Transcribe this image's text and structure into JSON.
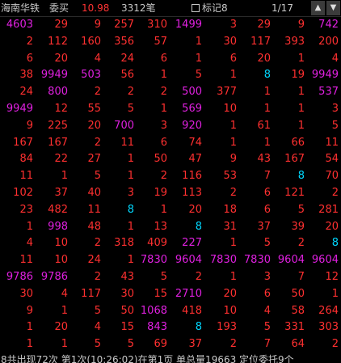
{
  "header": {
    "stock_name": "海南华铁",
    "order_type": "委买",
    "price": "10.98",
    "order_count": "3312笔",
    "mark_label": "标记8",
    "page": "1/17",
    "nav_up_icon": "triangle-up-icon",
    "nav_down_icon": "triangle-down-icon"
  },
  "colors": {
    "red": "#ff3030",
    "magenta": "#e020e0",
    "cyan": "#00d8ff",
    "background": "#000000"
  },
  "rows": [
    [
      [
        "4603",
        "m"
      ],
      [
        "29",
        "r"
      ],
      [
        "9",
        "r"
      ],
      [
        "257",
        "r"
      ],
      [
        "310",
        "r"
      ],
      [
        "1499",
        "m"
      ],
      [
        "3",
        "r"
      ],
      [
        "29",
        "r"
      ],
      [
        "9",
        "r"
      ],
      [
        "742",
        "m"
      ]
    ],
    [
      [
        "2",
        "r"
      ],
      [
        "112",
        "r"
      ],
      [
        "160",
        "r"
      ],
      [
        "356",
        "r"
      ],
      [
        "57",
        "r"
      ],
      [
        "1",
        "r"
      ],
      [
        "30",
        "r"
      ],
      [
        "117",
        "r"
      ],
      [
        "393",
        "r"
      ],
      [
        "200",
        "r"
      ]
    ],
    [
      [
        "6",
        "r"
      ],
      [
        "20",
        "r"
      ],
      [
        "4",
        "r"
      ],
      [
        "24",
        "r"
      ],
      [
        "6",
        "r"
      ],
      [
        "1",
        "r"
      ],
      [
        "6",
        "r"
      ],
      [
        "20",
        "r"
      ],
      [
        "1",
        "r"
      ],
      [
        "4",
        "r"
      ]
    ],
    [
      [
        "38",
        "r"
      ],
      [
        "9949",
        "m"
      ],
      [
        "503",
        "m"
      ],
      [
        "56",
        "r"
      ],
      [
        "1",
        "r"
      ],
      [
        "5",
        "r"
      ],
      [
        "1",
        "r"
      ],
      [
        "8",
        "c"
      ],
      [
        "19",
        "r"
      ],
      [
        "9949",
        "m"
      ]
    ],
    [
      [
        "24",
        "r"
      ],
      [
        "800",
        "m"
      ],
      [
        "2",
        "r"
      ],
      [
        "2",
        "r"
      ],
      [
        "2",
        "r"
      ],
      [
        "500",
        "m"
      ],
      [
        "377",
        "r"
      ],
      [
        "1",
        "r"
      ],
      [
        "1",
        "r"
      ],
      [
        "537",
        "m"
      ]
    ],
    [
      [
        "9949",
        "m"
      ],
      [
        "12",
        "r"
      ],
      [
        "55",
        "r"
      ],
      [
        "5",
        "r"
      ],
      [
        "1",
        "r"
      ],
      [
        "569",
        "m"
      ],
      [
        "10",
        "r"
      ],
      [
        "1",
        "r"
      ],
      [
        "1",
        "r"
      ],
      [
        "3",
        "r"
      ]
    ],
    [
      [
        "9",
        "r"
      ],
      [
        "225",
        "r"
      ],
      [
        "20",
        "r"
      ],
      [
        "700",
        "m"
      ],
      [
        "3",
        "r"
      ],
      [
        "920",
        "m"
      ],
      [
        "1",
        "r"
      ],
      [
        "61",
        "r"
      ],
      [
        "1",
        "r"
      ],
      [
        "5",
        "r"
      ]
    ],
    [
      [
        "167",
        "r"
      ],
      [
        "167",
        "r"
      ],
      [
        "2",
        "r"
      ],
      [
        "11",
        "r"
      ],
      [
        "6",
        "r"
      ],
      [
        "74",
        "r"
      ],
      [
        "1",
        "r"
      ],
      [
        "1",
        "r"
      ],
      [
        "66",
        "r"
      ],
      [
        "11",
        "r"
      ]
    ],
    [
      [
        "84",
        "r"
      ],
      [
        "22",
        "r"
      ],
      [
        "27",
        "r"
      ],
      [
        "1",
        "r"
      ],
      [
        "50",
        "r"
      ],
      [
        "47",
        "r"
      ],
      [
        "9",
        "r"
      ],
      [
        "43",
        "r"
      ],
      [
        "167",
        "r"
      ],
      [
        "54",
        "r"
      ]
    ],
    [
      [
        "11",
        "r"
      ],
      [
        "1",
        "r"
      ],
      [
        "5",
        "r"
      ],
      [
        "1",
        "r"
      ],
      [
        "2",
        "r"
      ],
      [
        "116",
        "r"
      ],
      [
        "53",
        "r"
      ],
      [
        "7",
        "r"
      ],
      [
        "8",
        "c"
      ],
      [
        "70",
        "r"
      ]
    ],
    [
      [
        "102",
        "r"
      ],
      [
        "37",
        "r"
      ],
      [
        "40",
        "r"
      ],
      [
        "3",
        "r"
      ],
      [
        "19",
        "r"
      ],
      [
        "113",
        "r"
      ],
      [
        "2",
        "r"
      ],
      [
        "6",
        "r"
      ],
      [
        "121",
        "r"
      ],
      [
        "2",
        "r"
      ]
    ],
    [
      [
        "23",
        "r"
      ],
      [
        "482",
        "r"
      ],
      [
        "11",
        "r"
      ],
      [
        "8",
        "c"
      ],
      [
        "1",
        "r"
      ],
      [
        "20",
        "r"
      ],
      [
        "18",
        "r"
      ],
      [
        "6",
        "r"
      ],
      [
        "5",
        "r"
      ],
      [
        "281",
        "r"
      ]
    ],
    [
      [
        "1",
        "r"
      ],
      [
        "998",
        "m"
      ],
      [
        "48",
        "r"
      ],
      [
        "1",
        "r"
      ],
      [
        "13",
        "r"
      ],
      [
        "8",
        "c"
      ],
      [
        "31",
        "r"
      ],
      [
        "37",
        "r"
      ],
      [
        "39",
        "r"
      ],
      [
        "20",
        "r"
      ]
    ],
    [
      [
        "4",
        "r"
      ],
      [
        "10",
        "r"
      ],
      [
        "2",
        "r"
      ],
      [
        "318",
        "r"
      ],
      [
        "409",
        "r"
      ],
      [
        "227",
        "m"
      ],
      [
        "1",
        "r"
      ],
      [
        "5",
        "r"
      ],
      [
        "2",
        "r"
      ],
      [
        "8",
        "c"
      ]
    ],
    [
      [
        "11",
        "r"
      ],
      [
        "10",
        "r"
      ],
      [
        "24",
        "r"
      ],
      [
        "1",
        "r"
      ],
      [
        "7830",
        "m"
      ],
      [
        "9604",
        "m"
      ],
      [
        "7830",
        "m"
      ],
      [
        "7830",
        "m"
      ],
      [
        "9604",
        "m"
      ],
      [
        "9604",
        "m"
      ]
    ],
    [
      [
        "9786",
        "m"
      ],
      [
        "9786",
        "m"
      ],
      [
        "2",
        "r"
      ],
      [
        "43",
        "r"
      ],
      [
        "5",
        "r"
      ],
      [
        "2",
        "r"
      ],
      [
        "1",
        "r"
      ],
      [
        "3",
        "r"
      ],
      [
        "7",
        "r"
      ],
      [
        "12",
        "r"
      ]
    ],
    [
      [
        "30",
        "r"
      ],
      [
        "4",
        "r"
      ],
      [
        "117",
        "r"
      ],
      [
        "30",
        "r"
      ],
      [
        "15",
        "r"
      ],
      [
        "2710",
        "m"
      ],
      [
        "20",
        "r"
      ],
      [
        "6",
        "r"
      ],
      [
        "50",
        "r"
      ],
      [
        "1",
        "r"
      ]
    ],
    [
      [
        "9",
        "r"
      ],
      [
        "1",
        "r"
      ],
      [
        "5",
        "r"
      ],
      [
        "50",
        "r"
      ],
      [
        "1068",
        "m"
      ],
      [
        "418",
        "r"
      ],
      [
        "10",
        "r"
      ],
      [
        "4",
        "r"
      ],
      [
        "58",
        "r"
      ],
      [
        "264",
        "r"
      ]
    ],
    [
      [
        "1",
        "r"
      ],
      [
        "20",
        "r"
      ],
      [
        "4",
        "r"
      ],
      [
        "15",
        "r"
      ],
      [
        "843",
        "m"
      ],
      [
        "8",
        "c"
      ],
      [
        "193",
        "r"
      ],
      [
        "5",
        "r"
      ],
      [
        "331",
        "r"
      ],
      [
        "303",
        "r"
      ]
    ],
    [
      [
        "1",
        "r"
      ],
      [
        "1",
        "r"
      ],
      [
        "5",
        "r"
      ],
      [
        "5",
        "r"
      ],
      [
        "69",
        "r"
      ],
      [
        "37",
        "r"
      ],
      [
        "2",
        "r"
      ],
      [
        "7",
        "r"
      ],
      [
        "64",
        "r"
      ],
      [
        "2",
        "r"
      ]
    ]
  ],
  "footer": {
    "status_text": "8共出现72次 第1次(10:26:02)在第1页 单总量19663 定位委托9个"
  }
}
